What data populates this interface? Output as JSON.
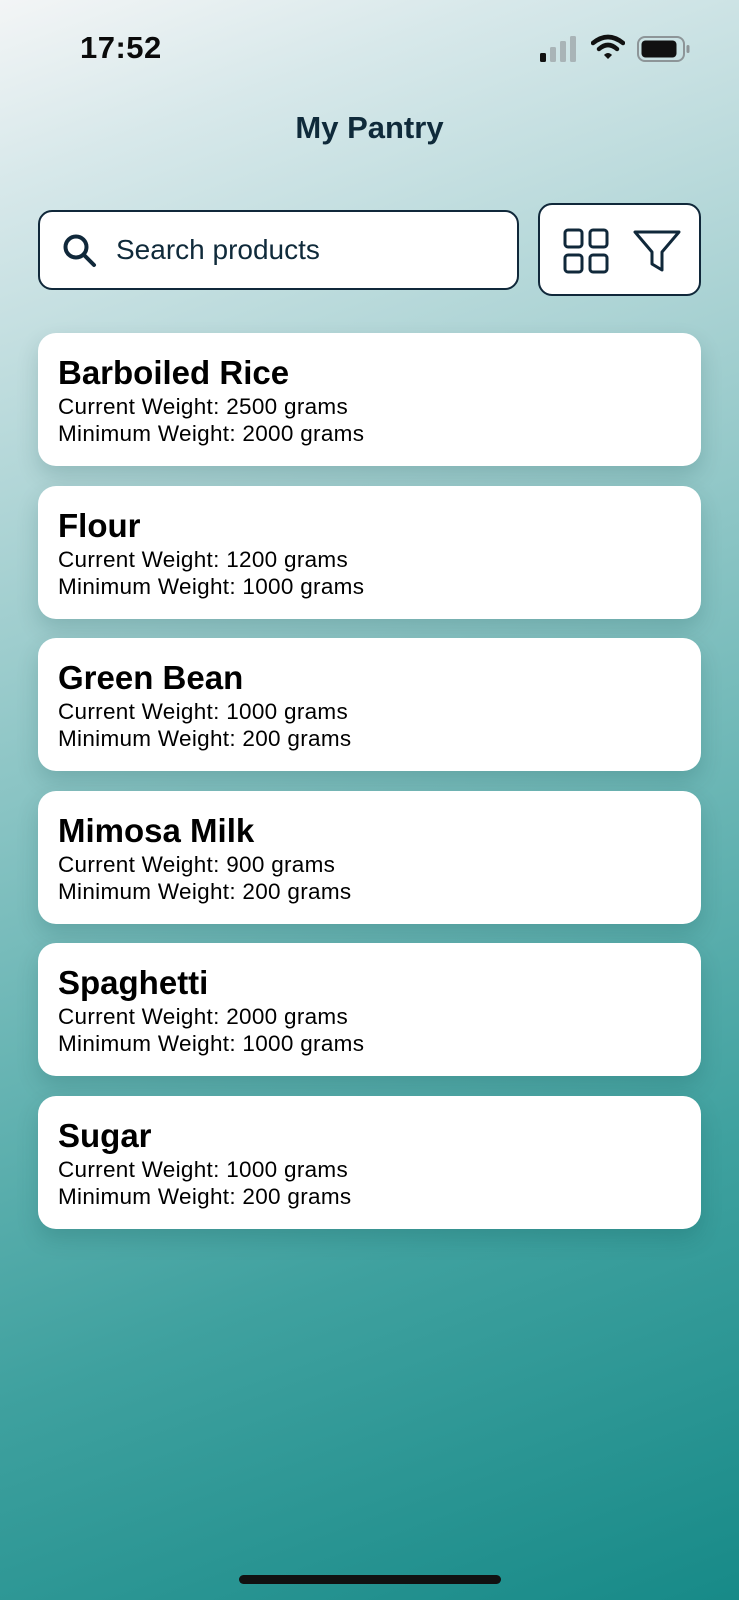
{
  "status_bar": {
    "time": "17:52"
  },
  "header": {
    "title": "My Pantry"
  },
  "search": {
    "placeholder": "Search products",
    "value": ""
  },
  "toolbar": {
    "grid_view_icon": "grid-icon",
    "filter_icon": "filter-icon"
  },
  "products": [
    {
      "name": "Barboiled Rice",
      "current": "Current Weight: 2500 grams",
      "minimum": "Minimum Weight: 2000 grams"
    },
    {
      "name": "Flour",
      "current": "Current Weight: 1200 grams",
      "minimum": "Minimum Weight: 1000 grams"
    },
    {
      "name": "Green Bean",
      "current": "Current Weight: 1000 grams",
      "minimum": "Minimum Weight: 200 grams"
    },
    {
      "name": "Mimosa Milk",
      "current": "Current Weight: 900 grams",
      "minimum": "Minimum Weight: 200 grams"
    },
    {
      "name": "Spaghetti",
      "current": "Current Weight: 2000 grams",
      "minimum": "Minimum Weight: 1000 grams"
    },
    {
      "name": "Sugar",
      "current": "Current Weight: 1000 grams",
      "minimum": "Minimum Weight: 200 grams"
    }
  ],
  "colors": {
    "accent": "#10283a",
    "gradient_top": "#f3f5f6",
    "gradient_bottom": "#178a88",
    "card": "#ffffff"
  }
}
